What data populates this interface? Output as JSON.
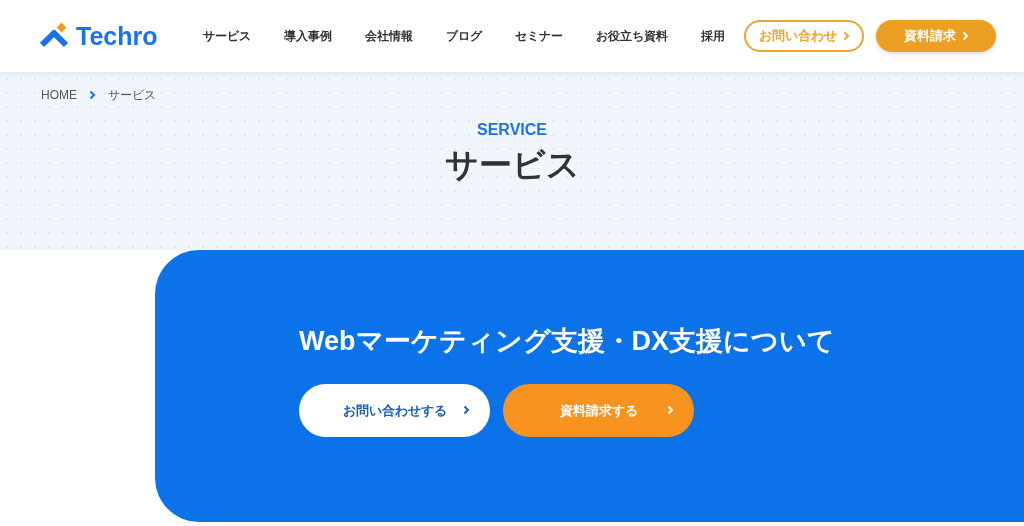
{
  "header": {
    "logo": "Techro",
    "nav": [
      {
        "label": "サービス"
      },
      {
        "label": "導入事例"
      },
      {
        "label": "会社情報"
      },
      {
        "label": "ブログ"
      },
      {
        "label": "セミナー"
      },
      {
        "label": "お役立ち資料"
      },
      {
        "label": "採用"
      }
    ],
    "buttons": [
      {
        "label": "お問い合わせ",
        "kind": "outline"
      },
      {
        "label": "資料請求",
        "kind": "filled"
      }
    ]
  },
  "breadcrumb": [
    {
      "label": "HOME"
    },
    {
      "label": "サービス"
    }
  ],
  "hero": {
    "eyebrow": "SERVICE",
    "title": "サービス"
  },
  "panel": {
    "heading": "Webマーケティング支援・DX支援について",
    "buttons": [
      {
        "label": "お問い合わせする",
        "kind": "white"
      },
      {
        "label": "資料請求する",
        "kind": "orange"
      }
    ]
  }
}
